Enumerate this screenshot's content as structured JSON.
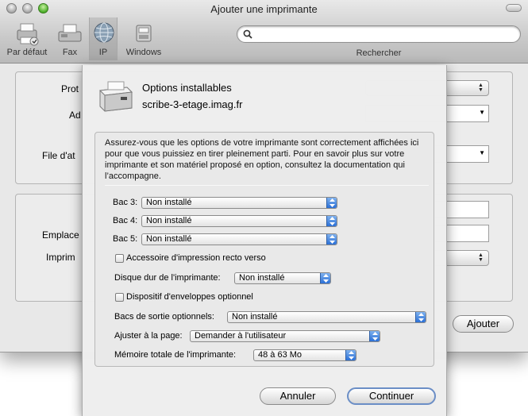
{
  "window": {
    "title": "Ajouter une imprimante"
  },
  "toolbar": {
    "items": [
      {
        "label": "Par défaut",
        "icon": "printer-icon"
      },
      {
        "label": "Fax",
        "icon": "fax-icon"
      },
      {
        "label": "IP",
        "icon": "globe-icon"
      },
      {
        "label": "Windows",
        "icon": "windows-printer-icon"
      }
    ],
    "search_label": "Rechercher",
    "search_value": ""
  },
  "background": {
    "labels": [
      "Prot",
      "Ad",
      "File d'at",
      "Emplace",
      "Imprim"
    ],
    "add_button": "Ajouter"
  },
  "sheet": {
    "title": "Options installables",
    "subtitle": "scribe-3-etage.imag.fr",
    "intro": "Assurez-vous que les options de votre imprimante sont correctement affichées ici pour que vous puissiez en tirer pleinement parti. Pour en savoir plus sur votre imprimante et son matériel proposé en option, consultez la documentation qui l’accompagne.",
    "trays": [
      {
        "label": "Bac 3:",
        "value": "Non installé"
      },
      {
        "label": "Bac 4:",
        "value": "Non installé"
      },
      {
        "label": "Bac 5:",
        "value": "Non installé"
      }
    ],
    "duplex": {
      "label": "Accessoire d'impression recto verso",
      "checked": false
    },
    "hard_disk": {
      "label": "Disque dur de l'imprimante:",
      "value": "Non installé"
    },
    "envelope": {
      "label": "Dispositif d'enveloppes optionnel",
      "checked": false
    },
    "output_bins": {
      "label": "Bacs de sortie optionnels:",
      "value": "Non installé"
    },
    "fit_page": {
      "label": "Ajuster à la page:",
      "value": "Demander à l'utilisateur"
    },
    "memory": {
      "label": "Mémoire totale de l'imprimante:",
      "value": "48 à 63 Mo"
    },
    "cancel": "Annuler",
    "continue": "Continuer"
  },
  "colors": {
    "accent": "#2a6fd6",
    "default_button_border": "#6b8ec6"
  }
}
